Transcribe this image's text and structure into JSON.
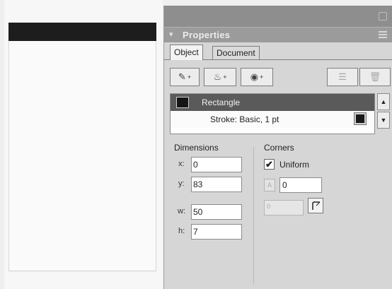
{
  "panel": {
    "title": "Properties",
    "collapse_glyph": "▾"
  },
  "tabs": [
    {
      "label": "Object",
      "active": true
    },
    {
      "label": "Document",
      "active": false
    }
  ],
  "toolbar": {
    "pen_icon": "pen-plus-icon",
    "fill_icon": "fill-plus-icon",
    "effect_icon": "effect-plus-icon",
    "buttons": [
      "+",
      "+",
      "+"
    ]
  },
  "object_list": {
    "rows": [
      {
        "label": "Rectangle",
        "selected": true
      },
      {
        "label": "Stroke: Basic, 1 pt",
        "selected": false
      }
    ]
  },
  "dimensions": {
    "heading": "Dimensions",
    "x_label": "x:",
    "x_value": "0",
    "y_label": "y:",
    "y_value": "83",
    "w_label": "w:",
    "w_value": "50",
    "h_label": "h:",
    "h_value": "7"
  },
  "corners": {
    "heading": "Corners",
    "uniform_label": "Uniform",
    "uniform_checked": true,
    "radius_value": "0",
    "radius2_value": "0"
  },
  "colors": {
    "selected_row_bg": "#5a5a5a",
    "panel_bg": "#d6d6d6",
    "title_bar_bg": "#9b9b9b"
  }
}
